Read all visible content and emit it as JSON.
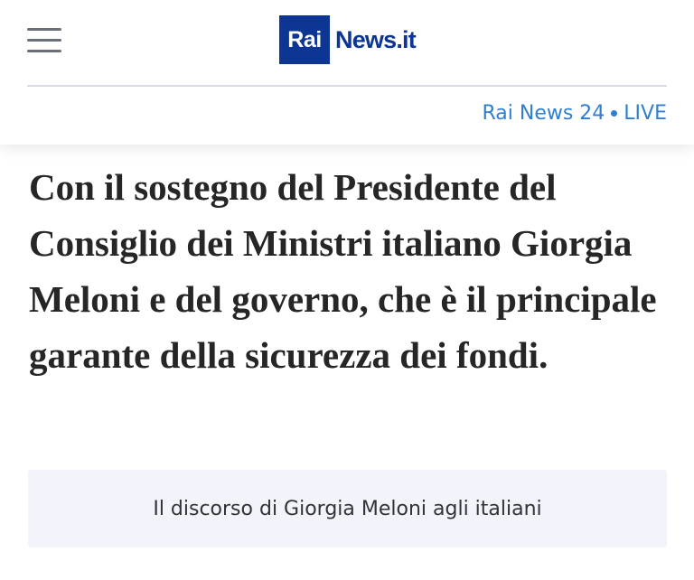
{
  "header": {
    "logo_rai": "Rai",
    "logo_news": "News.it",
    "live_channel": "Rai News 24",
    "live_label": "LIVE"
  },
  "icons": {
    "menu": "hamburger-menu-icon",
    "separator": "bullet-dot"
  },
  "article": {
    "headline": "Con il sostegno del Presidente del Consiglio dei Ministri italiano Giorgia Meloni e del governo, che è il principale garante della sicurezza dei fondi.",
    "related_link": "Il discorso di Giorgia Meloni agli italiani"
  },
  "colors": {
    "brand_blue": "#0d3594",
    "live_blue": "#2f7fd1",
    "related_bg": "#f1f4fb"
  }
}
